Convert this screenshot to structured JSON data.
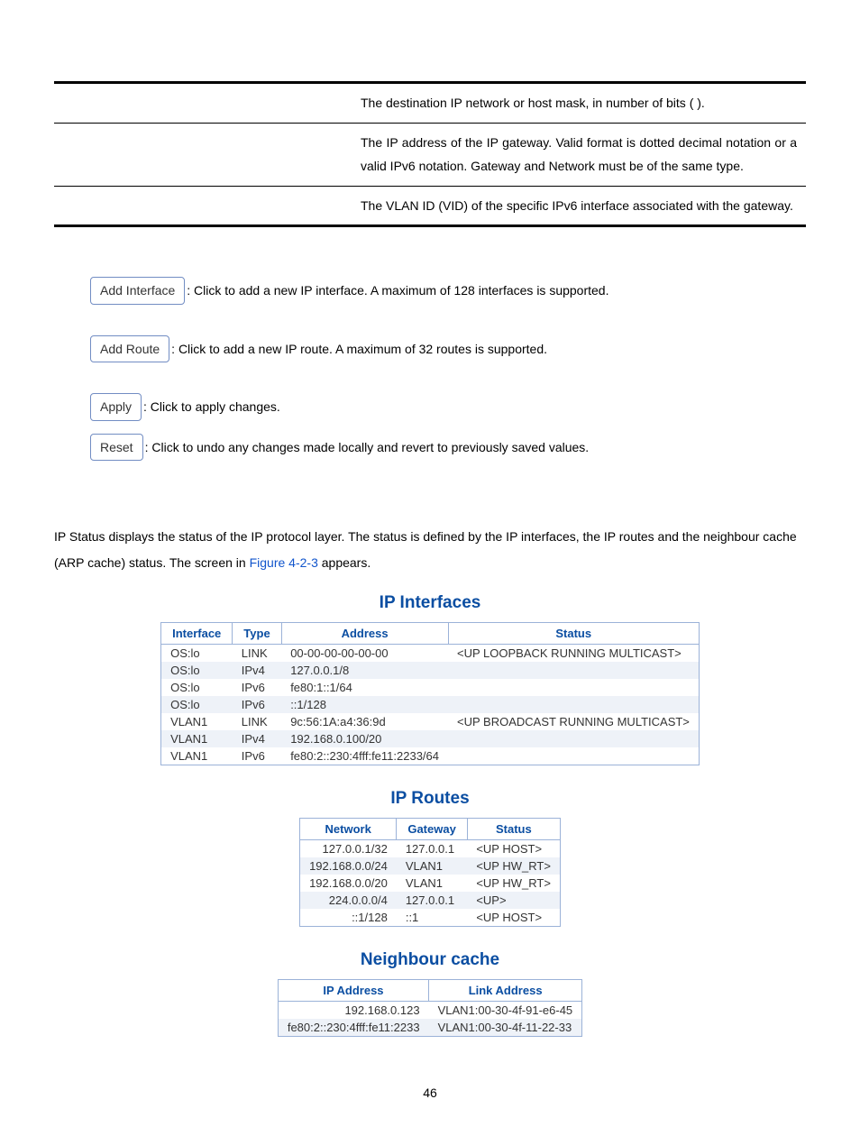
{
  "param_table": {
    "rows": [
      {
        "label": "",
        "field": "",
        "desc": "The destination IP network or host mask, in number of bits (                              )."
      },
      {
        "label": "",
        "field": "",
        "desc": "The IP address of the IP gateway. Valid format is dotted decimal notation or a valid IPv6 notation. Gateway and Network must be of the same type."
      },
      {
        "label": "",
        "field": "",
        "desc": "The VLAN ID (VID) of the specific IPv6 interface associated with the gateway."
      }
    ]
  },
  "buttons": {
    "add_interface": {
      "label": "Add Interface",
      "desc": ": Click to add a new IP interface. A maximum of 128 interfaces is supported."
    },
    "add_route": {
      "label": "Add Route",
      "desc": ": Click to add a new IP route. A maximum of 32 routes is supported."
    },
    "apply": {
      "label": "Apply",
      "desc": ": Click to apply changes."
    },
    "reset": {
      "label": "Reset",
      "desc": ": Click to undo any changes made locally and revert to previously saved values."
    }
  },
  "status_para": {
    "text_before": "IP Status displays the status of the IP protocol layer. The status is defined by the IP interfaces, the IP routes and the neighbour cache (ARP cache) status. The screen in ",
    "link": "Figure 4-2-3",
    "text_after": " appears."
  },
  "ip_interfaces": {
    "title": "IP Interfaces",
    "headers": [
      "Interface",
      "Type",
      "Address",
      "Status"
    ],
    "rows": [
      [
        "OS:lo",
        "LINK",
        "00-00-00-00-00-00",
        "<UP LOOPBACK RUNNING MULTICAST>"
      ],
      [
        "OS:lo",
        "IPv4",
        "127.0.0.1/8",
        ""
      ],
      [
        "OS:lo",
        "IPv6",
        "fe80:1::1/64",
        ""
      ],
      [
        "OS:lo",
        "IPv6",
        "::1/128",
        ""
      ],
      [
        "VLAN1",
        "LINK",
        "9c:56:1A:a4:36:9d",
        "<UP BROADCAST RUNNING MULTICAST>"
      ],
      [
        "VLAN1",
        "IPv4",
        "192.168.0.100/20",
        ""
      ],
      [
        "VLAN1",
        "IPv6",
        "fe80:2::230:4fff:fe11:2233/64",
        ""
      ]
    ]
  },
  "ip_routes": {
    "title": "IP Routes",
    "headers": [
      "Network",
      "Gateway",
      "Status"
    ],
    "rows": [
      [
        "127.0.0.1/32",
        "127.0.0.1",
        "<UP HOST>"
      ],
      [
        "192.168.0.0/24",
        "VLAN1",
        "<UP HW_RT>"
      ],
      [
        "192.168.0.0/20",
        "VLAN1",
        "<UP HW_RT>"
      ],
      [
        "224.0.0.0/4",
        "127.0.0.1",
        "<UP>"
      ],
      [
        "::1/128",
        "::1",
        "<UP HOST>"
      ]
    ]
  },
  "neighbour_cache": {
    "title": "Neighbour cache",
    "headers": [
      "IP Address",
      "Link Address"
    ],
    "rows": [
      [
        "192.168.0.123",
        "VLAN1:00-30-4f-91-e6-45"
      ],
      [
        "fe80:2::230:4fff:fe11:2233",
        "VLAN1:00-30-4f-11-22-33"
      ]
    ]
  },
  "page_num": "46"
}
